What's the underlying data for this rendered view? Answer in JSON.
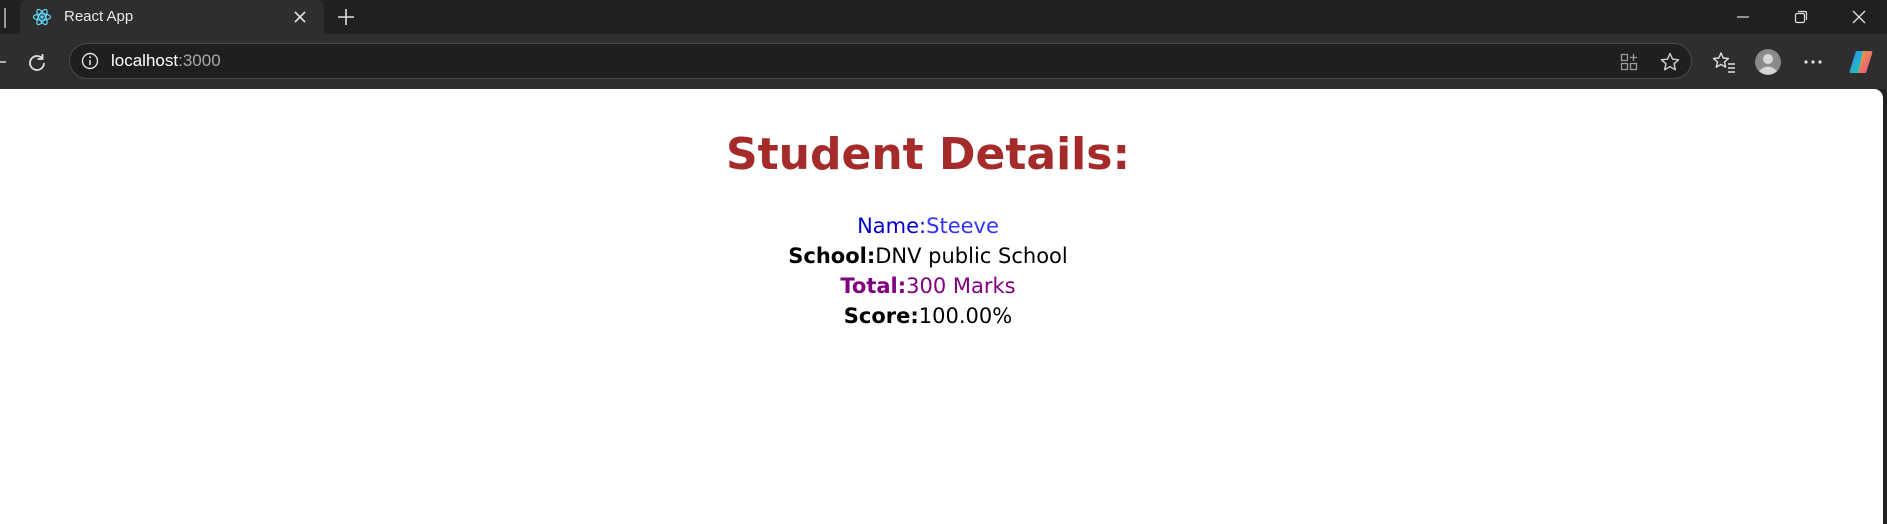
{
  "browser": {
    "tab": {
      "title": "React App",
      "favicon": "react-logo-icon"
    },
    "address_bar": {
      "host": "localhost",
      "port": ":3000"
    },
    "window_controls": [
      "minimize-icon",
      "restore-icon",
      "close-icon"
    ]
  },
  "page": {
    "heading": "Student Details:",
    "name": {
      "label": "Name:",
      "value": "Steeve"
    },
    "school": {
      "label": "School:",
      "value": "DNV public School"
    },
    "total": {
      "label": "Total:",
      "value": "300 Marks"
    },
    "score": {
      "label": "Score:",
      "value": "100.00%"
    }
  },
  "colors": {
    "heading": "#a52a2a",
    "name": "#0000cd",
    "total": "#800080",
    "chrome_dark": "#202020",
    "toolbar": "#2e2e2e"
  }
}
